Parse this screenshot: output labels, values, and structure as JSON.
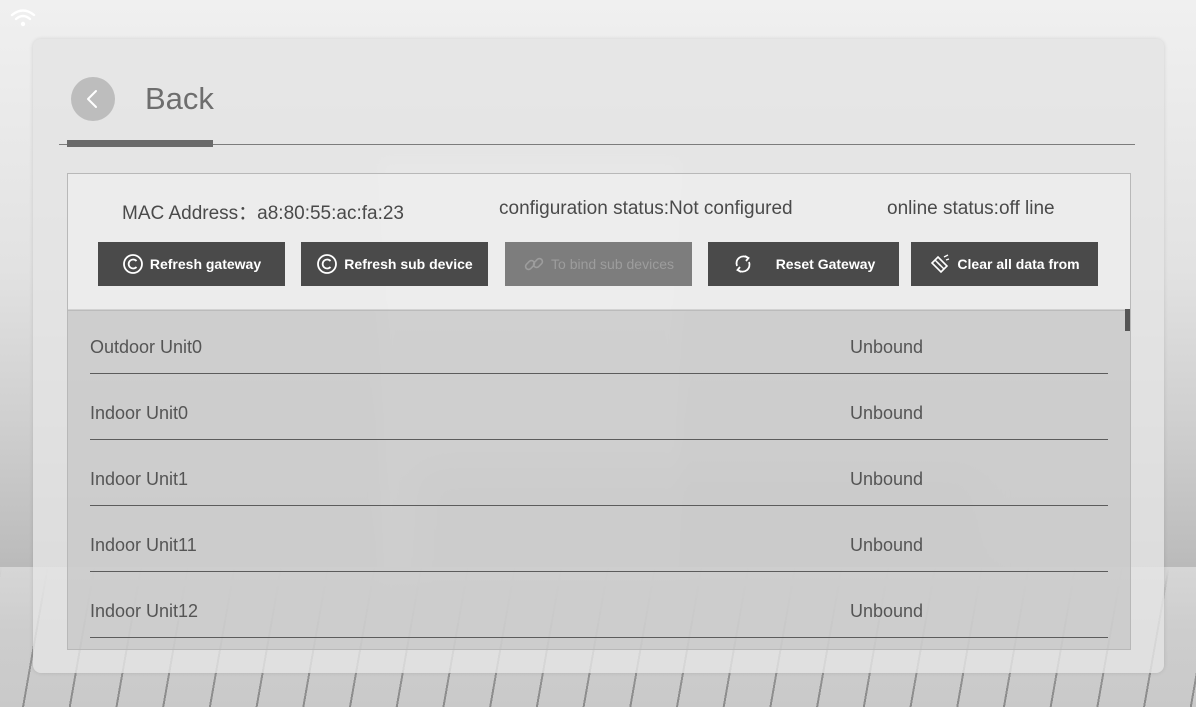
{
  "header": {
    "back_label": "Back"
  },
  "info": {
    "mac": "MAC Address：a8:80:55:ac:fa:23",
    "config_status": "configuration status:Not configured",
    "online_status": "online status:off line"
  },
  "toolbar": {
    "refresh_gateway": "Refresh gateway",
    "refresh_sub_device": "Refresh sub device",
    "bind_sub_devices": "To bind sub devices",
    "reset_gateway": "Reset Gateway",
    "clear_all": "Clear all data from"
  },
  "devices": [
    {
      "name": "Outdoor Unit0",
      "status": "Unbound"
    },
    {
      "name": "Indoor Unit0",
      "status": "Unbound"
    },
    {
      "name": "Indoor Unit1",
      "status": "Unbound"
    },
    {
      "name": "Indoor Unit11",
      "status": "Unbound"
    },
    {
      "name": "Indoor Unit12",
      "status": "Unbound"
    }
  ],
  "icons": {
    "status_bar": "wifi-icon",
    "back": "chevron-left-icon",
    "refresh_gateway": "copyright-refresh-icon",
    "refresh_sub_device": "copyright-refresh-icon",
    "bind_sub_devices": "link-icon",
    "reset_gateway": "sync-icon",
    "clear_all": "eraser-icon"
  },
  "colors": {
    "button_bg": "#4a4a4a",
    "button_disabled_bg": "#7d7d7d",
    "text": "#555555"
  }
}
